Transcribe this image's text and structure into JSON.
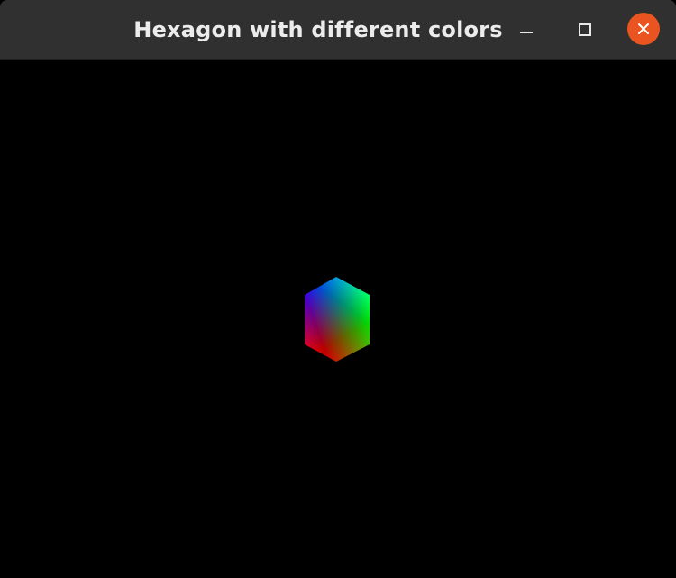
{
  "window": {
    "title": "Hexagon with different colors"
  },
  "titlebar_buttons": {
    "minimize_icon": "minimize-icon",
    "maximize_icon": "maximize-icon",
    "close_icon": "close-icon"
  },
  "colors": {
    "titlebar_bg": "#303030",
    "title_text": "#ececec",
    "close_button": "#e95420",
    "canvas_bg": "#000000",
    "hexagon_vertex_top": "#0000ff",
    "hexagon_vertex_right": "#00ff00",
    "hexagon_vertex_bottom": "#ff0000"
  }
}
